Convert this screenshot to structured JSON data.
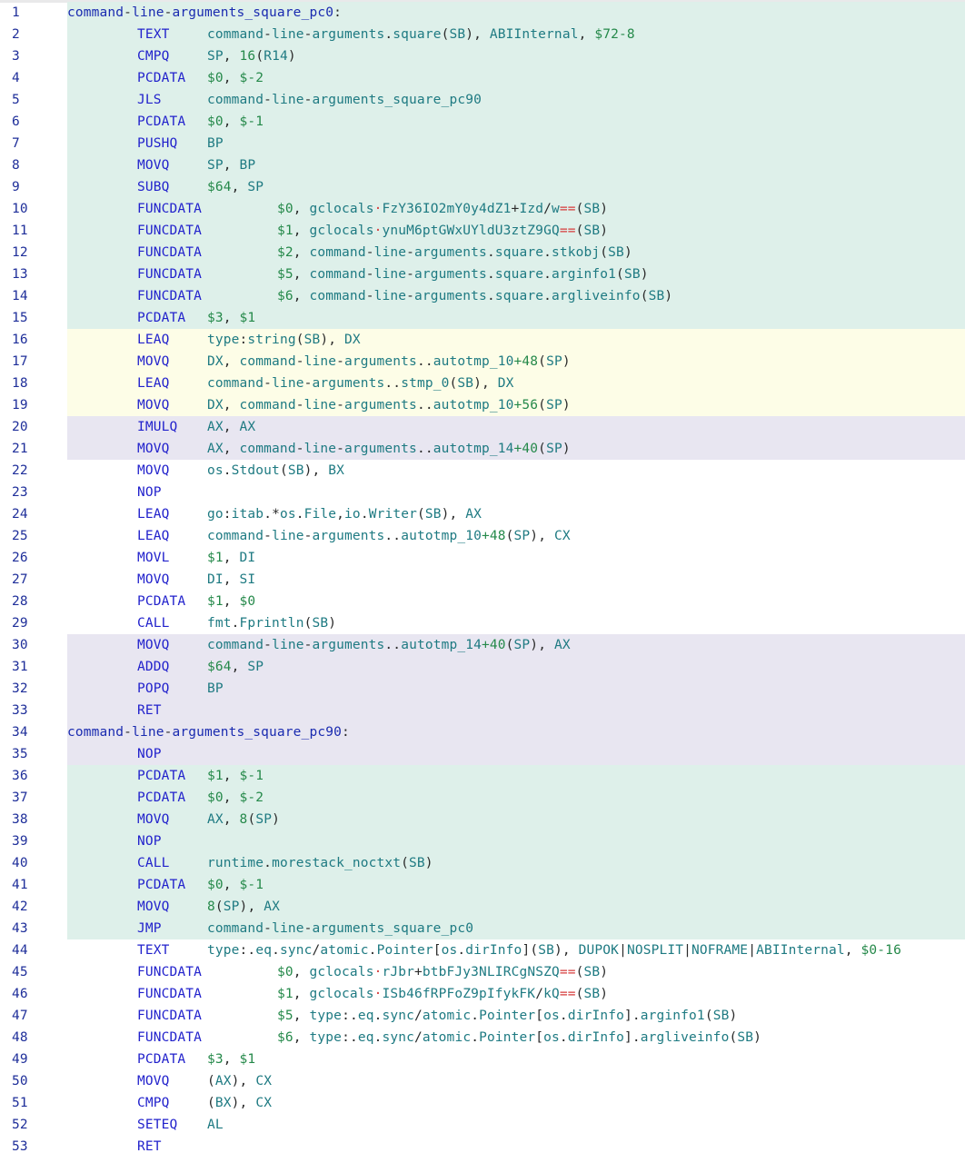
{
  "editor": {
    "lines": [
      {
        "n": "1",
        "bg": "green",
        "label": "command-line-arguments_square_pc0:"
      },
      {
        "n": "2",
        "bg": "green",
        "ins": "TEXT",
        "op": "command-line-arguments.square(SB), ABIInternal, $72-8"
      },
      {
        "n": "3",
        "bg": "green",
        "ins": "CMPQ",
        "op": "SP, 16(R14)"
      },
      {
        "n": "4",
        "bg": "green",
        "ins": "PCDATA",
        "op": "$0, $-2"
      },
      {
        "n": "5",
        "bg": "green",
        "ins": "JLS",
        "op": "command-line-arguments_square_pc90"
      },
      {
        "n": "6",
        "bg": "green",
        "ins": "PCDATA",
        "op": "$0, $-1"
      },
      {
        "n": "7",
        "bg": "green",
        "ins": "PUSHQ",
        "op": "BP"
      },
      {
        "n": "8",
        "bg": "green",
        "ins": "MOVQ",
        "op": "SP, BP"
      },
      {
        "n": "9",
        "bg": "green",
        "ins": "SUBQ",
        "op": "$64, SP"
      },
      {
        "n": "10",
        "bg": "green",
        "ins": "FUNCDATA",
        "long": true,
        "op": "$0, gclocals·FzY36IO2mY0y4dZ1+Izd/w==(SB)"
      },
      {
        "n": "11",
        "bg": "green",
        "ins": "FUNCDATA",
        "long": true,
        "op": "$1, gclocals·ynuM6ptGWxUYldU3ztZ9GQ==(SB)"
      },
      {
        "n": "12",
        "bg": "green",
        "ins": "FUNCDATA",
        "long": true,
        "op": "$2, command-line-arguments.square.stkobj(SB)"
      },
      {
        "n": "13",
        "bg": "green",
        "ins": "FUNCDATA",
        "long": true,
        "op": "$5, command-line-arguments.square.arginfo1(SB)"
      },
      {
        "n": "14",
        "bg": "green",
        "ins": "FUNCDATA",
        "long": true,
        "op": "$6, command-line-arguments.square.argliveinfo(SB)"
      },
      {
        "n": "15",
        "bg": "green",
        "ins": "PCDATA",
        "op": "$3, $1"
      },
      {
        "n": "16",
        "bg": "yellow",
        "ins": "LEAQ",
        "op": "type:string(SB), DX"
      },
      {
        "n": "17",
        "bg": "yellow",
        "ins": "MOVQ",
        "op": "DX, command-line-arguments..autotmp_10+48(SP)"
      },
      {
        "n": "18",
        "bg": "yellow",
        "ins": "LEAQ",
        "op": "command-line-arguments..stmp_0(SB), DX"
      },
      {
        "n": "19",
        "bg": "yellow",
        "ins": "MOVQ",
        "op": "DX, command-line-arguments..autotmp_10+56(SP)"
      },
      {
        "n": "20",
        "bg": "purple",
        "ins": "IMULQ",
        "op": "AX, AX"
      },
      {
        "n": "21",
        "bg": "purple",
        "ins": "MOVQ",
        "op": "AX, command-line-arguments..autotmp_14+40(SP)"
      },
      {
        "n": "22",
        "bg": "none",
        "ins": "MOVQ",
        "op": "os.Stdout(SB), BX"
      },
      {
        "n": "23",
        "bg": "none",
        "ins": "NOP",
        "op": ""
      },
      {
        "n": "24",
        "bg": "none",
        "ins": "LEAQ",
        "op": "go:itab.*os.File,io.Writer(SB), AX"
      },
      {
        "n": "25",
        "bg": "none",
        "ins": "LEAQ",
        "op": "command-line-arguments..autotmp_10+48(SP), CX"
      },
      {
        "n": "26",
        "bg": "none",
        "ins": "MOVL",
        "op": "$1, DI"
      },
      {
        "n": "27",
        "bg": "none",
        "ins": "MOVQ",
        "op": "DI, SI"
      },
      {
        "n": "28",
        "bg": "none",
        "ins": "PCDATA",
        "op": "$1, $0"
      },
      {
        "n": "29",
        "bg": "none",
        "ins": "CALL",
        "op": "fmt.Fprintln(SB)"
      },
      {
        "n": "30",
        "bg": "purple",
        "ins": "MOVQ",
        "op": "command-line-arguments..autotmp_14+40(SP), AX"
      },
      {
        "n": "31",
        "bg": "purple",
        "ins": "ADDQ",
        "op": "$64, SP"
      },
      {
        "n": "32",
        "bg": "purple",
        "ins": "POPQ",
        "op": "BP"
      },
      {
        "n": "33",
        "bg": "purple",
        "ins": "RET",
        "op": ""
      },
      {
        "n": "34",
        "bg": "purple",
        "label": "command-line-arguments_square_pc90:"
      },
      {
        "n": "35",
        "bg": "purple",
        "ins": "NOP",
        "op": ""
      },
      {
        "n": "36",
        "bg": "green",
        "ins": "PCDATA",
        "op": "$1, $-1"
      },
      {
        "n": "37",
        "bg": "green",
        "ins": "PCDATA",
        "op": "$0, $-2"
      },
      {
        "n": "38",
        "bg": "green",
        "ins": "MOVQ",
        "op": "AX, 8(SP)"
      },
      {
        "n": "39",
        "bg": "green",
        "ins": "NOP",
        "op": ""
      },
      {
        "n": "40",
        "bg": "green",
        "ins": "CALL",
        "op": "runtime.morestack_noctxt(SB)"
      },
      {
        "n": "41",
        "bg": "green",
        "ins": "PCDATA",
        "op": "$0, $-1"
      },
      {
        "n": "42",
        "bg": "green",
        "ins": "MOVQ",
        "op": "8(SP), AX"
      },
      {
        "n": "43",
        "bg": "green",
        "ins": "JMP",
        "op": "command-line-arguments_square_pc0"
      },
      {
        "n": "44",
        "bg": "none",
        "ins": "TEXT",
        "op": "type:.eq.sync/atomic.Pointer[os.dirInfo](SB), DUPOK|NOSPLIT|NOFRAME|ABIInternal, $0-16"
      },
      {
        "n": "45",
        "bg": "none",
        "ins": "FUNCDATA",
        "long": true,
        "op": "$0, gclocals·rJbr+btbFJy3NLIRCgNSZQ==(SB)"
      },
      {
        "n": "46",
        "bg": "none",
        "ins": "FUNCDATA",
        "long": true,
        "op": "$1, gclocals·ISb46fRPFoZ9pIfykFK/kQ==(SB)"
      },
      {
        "n": "47",
        "bg": "none",
        "ins": "FUNCDATA",
        "long": true,
        "op": "$5, type:.eq.sync/atomic.Pointer[os.dirInfo].arginfo1(SB)"
      },
      {
        "n": "48",
        "bg": "none",
        "ins": "FUNCDATA",
        "long": true,
        "op": "$6, type:.eq.sync/atomic.Pointer[os.dirInfo].argliveinfo(SB)"
      },
      {
        "n": "49",
        "bg": "none",
        "ins": "PCDATA",
        "op": "$3, $1"
      },
      {
        "n": "50",
        "bg": "none",
        "ins": "MOVQ",
        "op": "(AX), CX"
      },
      {
        "n": "51",
        "bg": "none",
        "ins": "CMPQ",
        "op": "(BX), CX"
      },
      {
        "n": "52",
        "bg": "none",
        "ins": "SETEQ",
        "op": "AL"
      },
      {
        "n": "53",
        "bg": "none",
        "ins": "RET",
        "op": ""
      }
    ]
  },
  "colors": {
    "green_bg": "#def0ea",
    "yellow_bg": "#fdfde7",
    "purple_bg": "#e8e6f1",
    "instruction": "#2222cc",
    "operand": "#1e7a82",
    "number": "#25894a",
    "label": "#1a2bb0",
    "line_number": "#1f2f9a"
  }
}
